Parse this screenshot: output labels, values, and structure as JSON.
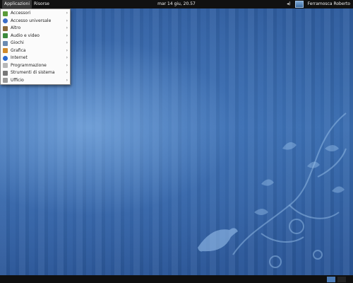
{
  "topbar": {
    "applications": "Applicazioni",
    "places": "Risorse",
    "clock": "mar 14 giu, 20.57",
    "user": "Ferramosca Roberto",
    "volume_icon": "speaker-icon"
  },
  "menu": {
    "items": [
      {
        "label": "Accessori",
        "icon": "accessories-icon",
        "color": "#5b9b3a"
      },
      {
        "label": "Accesso universale",
        "icon": "accessibility-icon",
        "color": "#3a6ec7"
      },
      {
        "label": "Altro",
        "icon": "other-icon",
        "color": "#8a6a3a"
      },
      {
        "label": "Audio e video",
        "icon": "multimedia-icon",
        "color": "#3c8a3c"
      },
      {
        "label": "Giochi",
        "icon": "games-icon",
        "color": "#6a8ab0"
      },
      {
        "label": "Grafica",
        "icon": "graphics-icon",
        "color": "#d08a2a"
      },
      {
        "label": "Internet",
        "icon": "internet-icon",
        "color": "#2a6ad0"
      },
      {
        "label": "Programmazione",
        "icon": "development-icon",
        "color": "#b7b7b7"
      },
      {
        "label": "Strumenti di sistema",
        "icon": "system-tools-icon",
        "color": "#777777"
      },
      {
        "label": "Ufficio",
        "icon": "office-icon",
        "color": "#9a9a9a"
      }
    ]
  },
  "colors": {
    "topbar": "#111111",
    "desktop": "#3a6db0",
    "workspace_active": "#4a7ab5"
  }
}
